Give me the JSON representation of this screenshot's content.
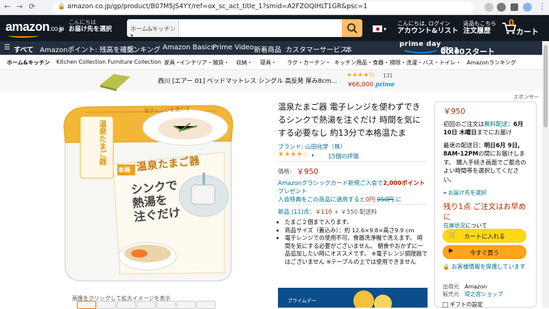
{
  "browser": {
    "url": "amazon.co.jp/gp/product/B07M5JS4YY/ref=ox_sc_act_title_1?smid=A2FZOQIHLT1GR&psc=1"
  },
  "header": {
    "logo_text": "amazon",
    "logo_suffix": ".co.jp",
    "deliver_line1": "こんにちは",
    "deliver_line2": "お届け先を選択",
    "search_category": "ホーム&キッチン",
    "search_placeholder": "",
    "account_line1": "こんにちは, ログイン",
    "account_line2": "アカウント&リスト",
    "orders_line1": "返品もこちら",
    "orders_line2": "注文履歴",
    "cart_count": "0",
    "cart_label": "カート"
  },
  "belt": {
    "all_label": "すべて",
    "items": [
      "Amazonポイント: 残高を確認",
      "ランキング",
      "Amazon Basics",
      "Prime Video",
      "新着商品",
      "カスタマーサービス",
      "本"
    ],
    "prime_day_label": "prime day",
    "prime_day_date": "6/21",
    "prime_day_weekday": "(月)",
    "prime_day_time": "00:00スタート"
  },
  "subnav": {
    "items": [
      "ホーム&キッチン",
      "Kitchen Collection",
      "Furniture Collection",
      "家具・",
      "インテリア・雑貨・",
      "収納・",
      "寝具・",
      "ラグ・カーテン・",
      "キッチン用品・食器・",
      "掃除・洗濯・バス・トイレ・",
      "Amazonランキング"
    ]
  },
  "promo": {
    "text": "西川 [エアー 01] ベッドマットレス シングル 高反発 厚み8cm...",
    "rating_count": "131",
    "price": "¥66,000",
    "prime": "prime",
    "sponsor": "スポンサー"
  },
  "product": {
    "title": "温泉たまご器 電子レンジを使わずできるシンクで熱湯を注ぐだけ 時間を気にする必要なし 約13分で本格温たま",
    "brand": "ブランド: 山田化学（株）",
    "stars": "★★★★☆",
    "rating_count": "15個の評価",
    "price_label": "価格:",
    "price": "￥950",
    "card_offer_1": "Amazonクラシックカード新規ご入会で",
    "card_offer_points": "2,000ポイント",
    "card_offer_2": "プレゼント",
    "card_offer_3": "入会特典をこの商品に適用すると",
    "card_offer_price": "0円",
    "card_offer_old": "950円",
    "card_offer_4": "に",
    "new_label": "新品 (11)点：",
    "new_price": "￥110",
    "new_shipping": "+ ￥550 配送料",
    "bullets": [
      "たまご２個まで入ります。",
      "商品サイズ（蓋込み）：約 12.6×9.8×高さ9.9 cm",
      "電子レンジでの使用不可。食器洗浄機で洗えます。 時間を気にする必要がございません。 朝食やおかずに一品追加したい時にオススメです。 ※電子レンジ調理器ではございません ※テーブルの上では使用できません"
    ],
    "image_caption": "画像をクリックして拡大イメージを表示",
    "image_texts": {
      "top_badge": "本格",
      "vertical_title": "温泉たまご器",
      "main_badge": "本格",
      "main_title": "温泉たまご器",
      "catch_line1": "シンクで",
      "catch_line2": "熱湯を",
      "catch_line3": "注ぐだけ",
      "note": "電子レンジを使わず",
      "maker": "YAMADA"
    },
    "card_banner": "プライムデー"
  },
  "buybox": {
    "price": "￥950",
    "shipping_1": "初回のご注文は",
    "shipping_free": "無料配送",
    "shipping_2": "：",
    "shipping_date": "6月10日 木曜日",
    "shipping_3": "までにお届け",
    "fastest_1": "最速の配送日：",
    "fastest_date": "明日6月 9日, 8AM-12PM",
    "fastest_2": "の間にお届けします。 購入手続き画面でご都合のよい時間帯を選択してください。",
    "location": "お届け先を選択",
    "stock_warning": "残り1点 ご注文はお早めに",
    "stock_link": "在庫状況",
    "stock_suffix": "について",
    "add_to_cart": "カートに入れる",
    "buy_now": "今すぐ買う",
    "secure": "お客様情報を保護しています",
    "ships_from_label": "出荷元",
    "ships_from": "Amazon",
    "sold_by_label": "販売元",
    "sold_by": "堤之宮ショップ",
    "gift_option": "ギフトの設定"
  },
  "colors": {
    "header": "#131921",
    "belt": "#232f3e",
    "price": "#b12704",
    "link": "#007185",
    "cart_button": "#ffd814",
    "buy_button": "#ffa41c",
    "orange": "#ff9900",
    "stock_red": "#b12704"
  }
}
